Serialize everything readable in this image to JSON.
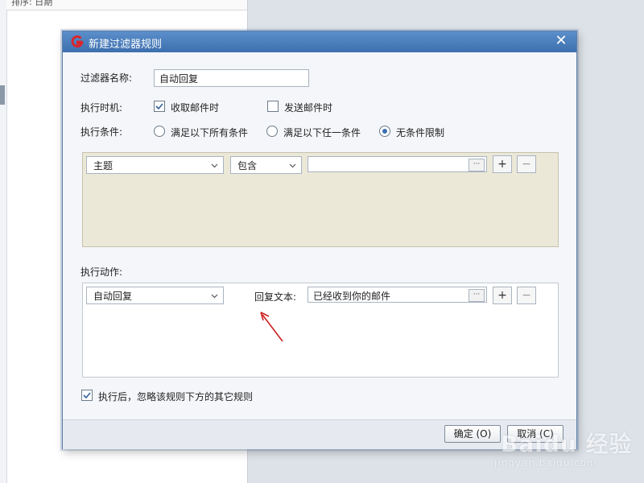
{
  "background": {
    "sort_label": "排序: 日期"
  },
  "dialog": {
    "title": "新建过滤器规则",
    "filter_name_label": "过滤器名称:",
    "filter_name_value": "自动回复",
    "exec_time_label": "执行时机:",
    "exec_time_options": [
      {
        "label": "收取邮件时",
        "checked": true
      },
      {
        "label": "发送邮件时",
        "checked": false
      }
    ],
    "exec_condition_label": "执行条件:",
    "condition_options": [
      {
        "label": "满足以下所有条件",
        "selected": false
      },
      {
        "label": "满足以下任一条件",
        "selected": false
      },
      {
        "label": "无条件限制",
        "selected": true
      }
    ],
    "condition_row": {
      "field": "主题",
      "operator": "包含",
      "value": "",
      "ellipsis": "···",
      "add": "+",
      "remove": "−"
    },
    "action_label": "执行动作:",
    "action_row": {
      "action": "自动回复",
      "reply_text_label": "回复文本:",
      "reply_text_value": "已经收到你的邮件",
      "ellipsis": "···",
      "add": "+",
      "remove": "−"
    },
    "skip_rules": {
      "label": "执行后，忽略该规则下方的其它规则",
      "checked": true
    },
    "ok_label": "确定 (O)",
    "cancel_label": "取消 (C)"
  },
  "watermark": {
    "brand": "Baidu 经验",
    "url": "jingyan.baidu.com"
  },
  "colors": {
    "title_bar": "#4a7fbf",
    "condition_panel": "#ebe8d8",
    "arrow": "#cc1f1f",
    "app_icon": "#d9262c"
  },
  "icons": {
    "app": "app-logo-icon",
    "close": "close-icon",
    "dropdown": "chevron-down-icon",
    "annotation": "red-arrow-icon"
  }
}
